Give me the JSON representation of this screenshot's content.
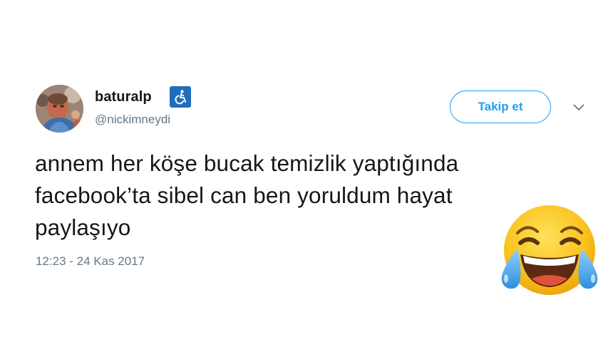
{
  "author": {
    "display_name": "baturalp",
    "handle": "@nickimneydi",
    "badge_icon": "wheelchair-accessibility-icon",
    "avatar_icon": "profile-photo"
  },
  "follow_button": {
    "label": "Takip et"
  },
  "menu_icon": "chevron-down-icon",
  "tweet": {
    "lines": [
      "annem her köşe bucak temizlik yaptığında",
      "facebook’ta sibel can ben yoruldum hayat",
      "paylaşıyo"
    ],
    "timestamp": "12:23 - 24 Kas 2017"
  },
  "overlay_emoji": "tears-of-joy-emoji",
  "colors": {
    "accent": "#1da1f2",
    "text": "#14171a",
    "muted": "#657786",
    "badge": "#1f6dbb",
    "emoji_face": "#f9c41f",
    "emoji_tears": "#3b9fe3"
  }
}
